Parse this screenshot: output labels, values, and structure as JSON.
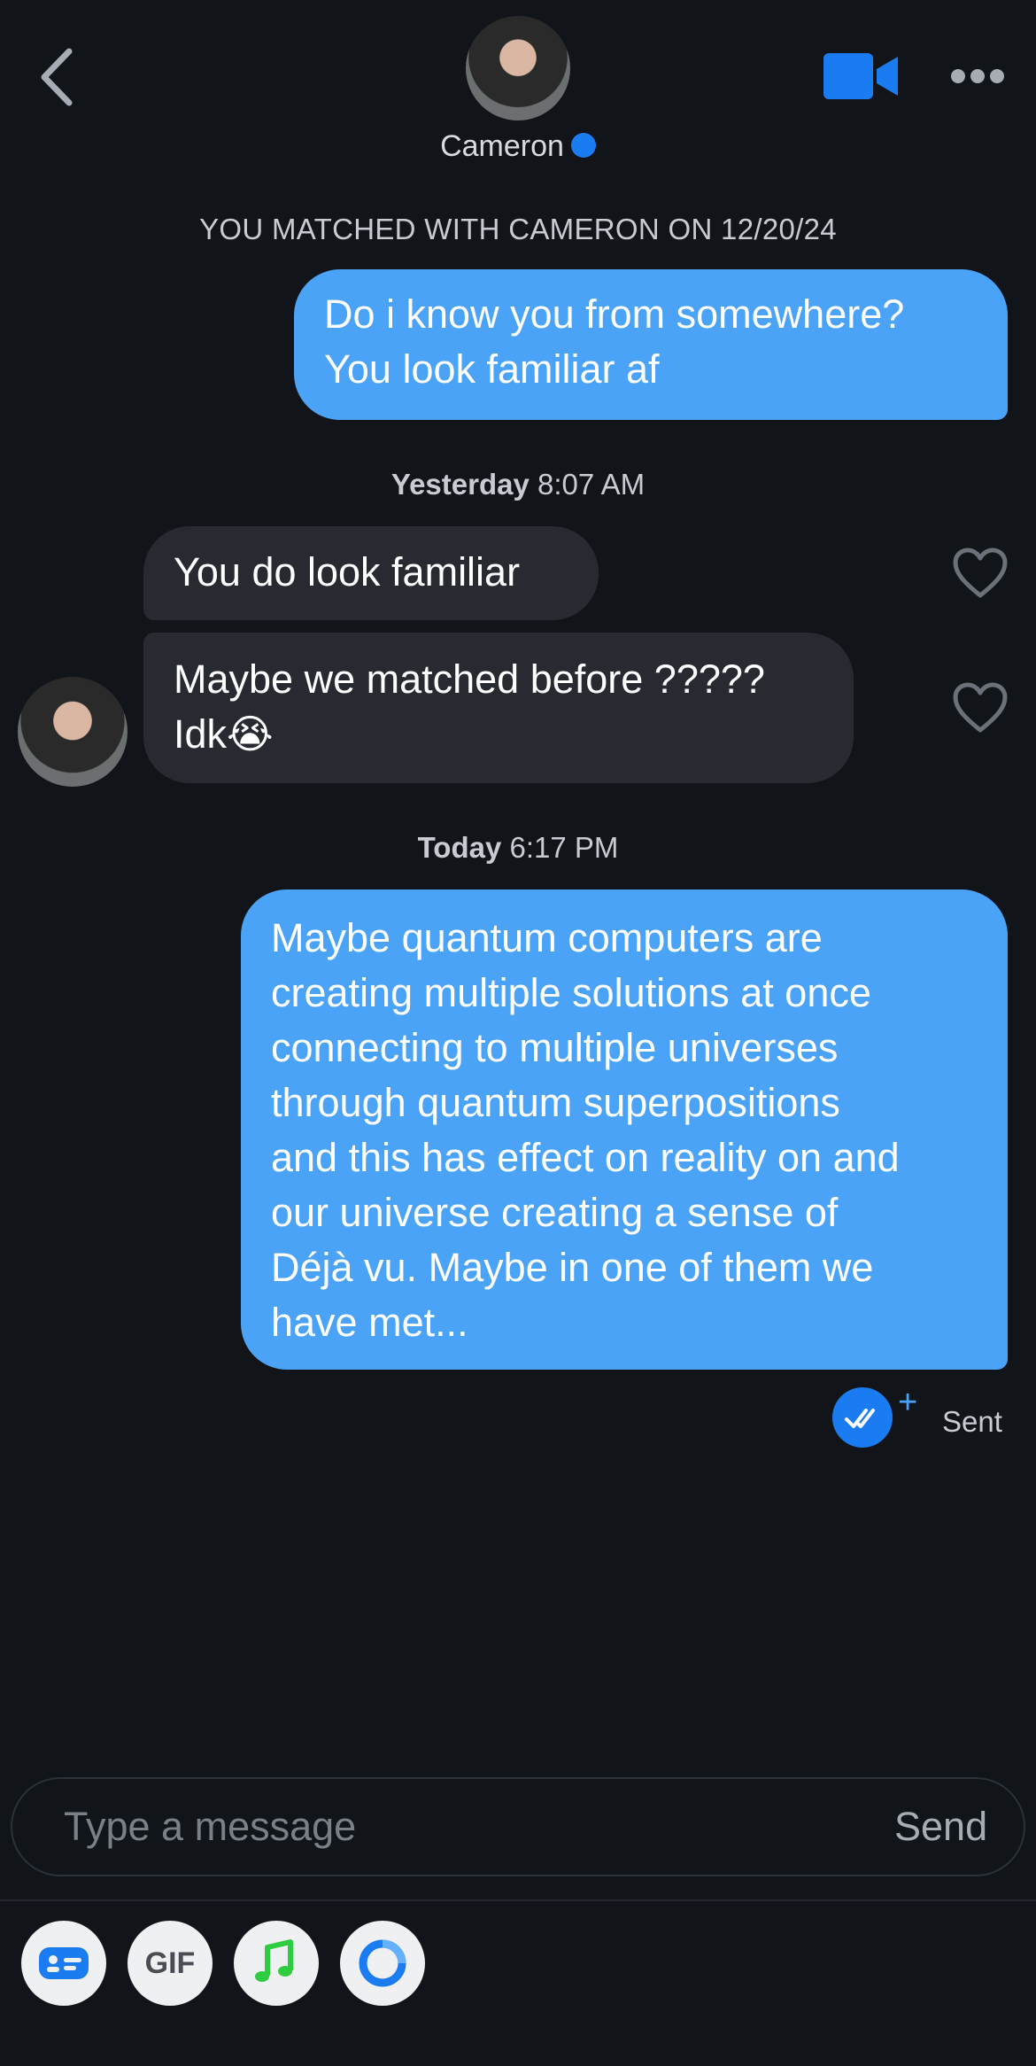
{
  "header": {
    "name": "Cameron",
    "icons": [
      "back-icon",
      "verified-badge-icon",
      "video-call-icon",
      "more-icon"
    ]
  },
  "match_banner": "YOU MATCHED WITH CAMERON ON 12/20/24",
  "messages": [
    {
      "from": "me",
      "lines": [
        "Do i know you from somewhere?",
        "You look familiar af"
      ]
    },
    {
      "from": "them",
      "lines": [
        "You do look familiar"
      ]
    },
    {
      "from": "them",
      "lines": [
        "Maybe we matched before ?????",
        "Idk😭"
      ]
    },
    {
      "from": "me",
      "lines": [
        "Maybe quantum computers are",
        "creating multiple solutions at once",
        "connecting to multiple universes",
        "through quantum superpositions",
        "and this has effect on reality on and",
        "our universe creating a sense of",
        "Déjà vu. Maybe in one of them we",
        "have met..."
      ]
    }
  ],
  "timestamps": [
    {
      "day": "Yesterday",
      "time": "8:07 AM"
    },
    {
      "day": "Today",
      "time": "6:17 PM"
    }
  ],
  "status": {
    "sent_label": "Sent",
    "plus": "+"
  },
  "composer": {
    "placeholder": "Type a message",
    "send_label": "Send"
  },
  "toolbar": {
    "gif_label": "GIF",
    "icons": [
      "contact-card-icon",
      "gif-icon",
      "music-note-icon",
      "ring-icon"
    ]
  },
  "colors": {
    "background": "#111419",
    "outgoing_bubble": "#4aa3f7",
    "incoming_bubble": "#272a31",
    "accent": "#1b7cf2",
    "music_green": "#2ecc40"
  }
}
